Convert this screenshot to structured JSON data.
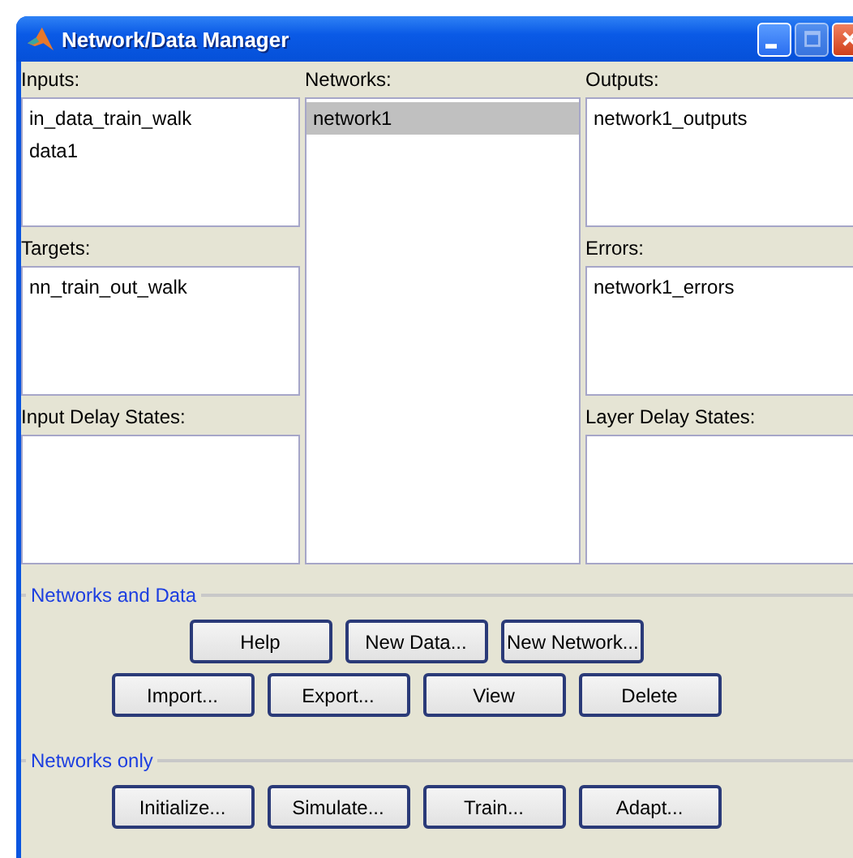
{
  "window": {
    "title": "Network/Data Manager",
    "controls": [
      {
        "kind": "minimize",
        "disabled": false
      },
      {
        "kind": "maximize",
        "disabled": true
      },
      {
        "kind": "close",
        "disabled": false
      }
    ]
  },
  "columns": [
    {
      "panels": [
        {
          "label": "Inputs:",
          "items": [
            {
              "text": "in_data_train_walk",
              "selected": false
            },
            {
              "text": "data1",
              "selected": false
            }
          ]
        },
        {
          "label": "Targets:",
          "items": [
            {
              "text": "nn_train_out_walk",
              "selected": false
            }
          ]
        },
        {
          "label": "Input Delay States:"
        }
      ]
    },
    {
      "panels": [
        {
          "label": "Networks:",
          "items": [
            {
              "text": "network1",
              "selected": true
            }
          ]
        }
      ]
    },
    {
      "panels": [
        {
          "label": "Outputs:",
          "items": [
            {
              "text": "network1_outputs",
              "selected": false
            }
          ]
        },
        {
          "label": "Errors:",
          "items": [
            {
              "text": "network1_errors",
              "selected": false
            }
          ]
        },
        {
          "label": "Layer Delay States:"
        }
      ]
    }
  ],
  "groups": [
    {
      "title": "Networks and Data",
      "rows": [
        [
          "Help",
          "New Data...",
          "New Network..."
        ],
        [
          "Import...",
          "Export...",
          "View",
          "Delete"
        ]
      ]
    },
    {
      "title": "Networks only",
      "rows": [
        [
          "Initialize...",
          "Simulate...",
          "Train...",
          "Adapt..."
        ]
      ]
    }
  ]
}
